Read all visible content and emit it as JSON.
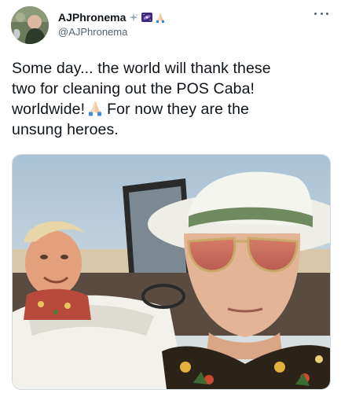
{
  "tweet": {
    "author": {
      "display_name": "AJPhronema",
      "handle": "@AJPhronema",
      "name_emojis": [
        "sparkle-emoji",
        "galaxy-emoji",
        "praying-hands-emoji"
      ]
    },
    "more_menu_icon": "more-horizontal-icon",
    "text_lines": [
      "Some day... the world will thank these",
      "two for cleaning out the POS Caba!",
      "worldwide!",
      "For now they are the",
      "unsung heroes."
    ],
    "inline_emoji": "praying-hands-emoji",
    "colors": {
      "text": "#0f1419",
      "secondary": "#536471",
      "border": "#cfd9de"
    }
  }
}
